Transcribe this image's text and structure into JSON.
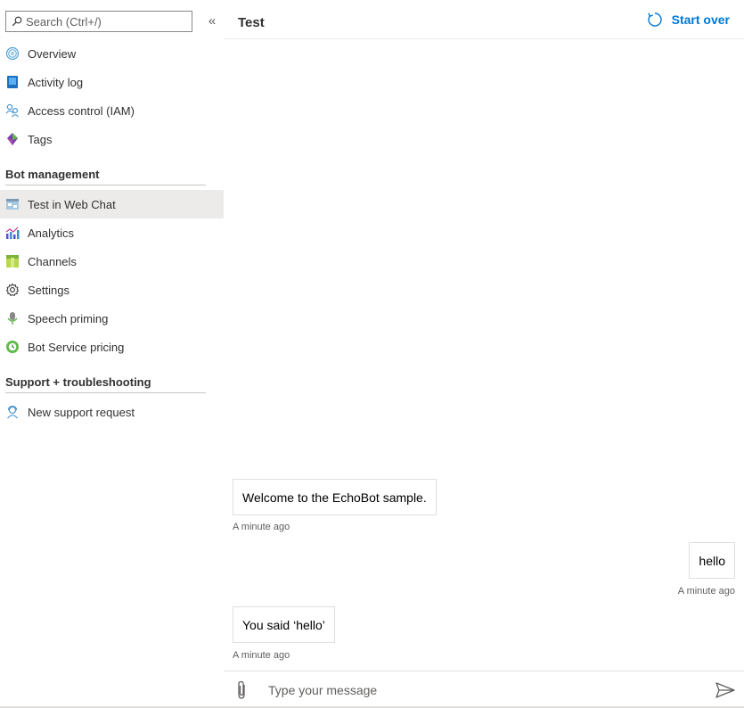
{
  "sidebar": {
    "search": {
      "placeholder": "Search (Ctrl+/)"
    },
    "collapse_glyph": "«",
    "items_top": [
      {
        "label": "Overview",
        "icon": "overview-icon"
      },
      {
        "label": "Activity log",
        "icon": "activity-log-icon"
      },
      {
        "label": "Access control (IAM)",
        "icon": "access-control-icon"
      },
      {
        "label": "Tags",
        "icon": "tags-icon"
      }
    ],
    "sections": [
      {
        "title": "Bot management",
        "items": [
          {
            "label": "Test in Web Chat",
            "icon": "web-chat-icon",
            "active": true
          },
          {
            "label": "Analytics",
            "icon": "analytics-icon"
          },
          {
            "label": "Channels",
            "icon": "channels-icon"
          },
          {
            "label": "Settings",
            "icon": "settings-icon"
          },
          {
            "label": "Speech priming",
            "icon": "speech-priming-icon"
          },
          {
            "label": "Bot Service pricing",
            "icon": "pricing-icon"
          }
        ]
      },
      {
        "title": "Support + troubleshooting",
        "items": [
          {
            "label": "New support request",
            "icon": "support-request-icon"
          }
        ]
      }
    ]
  },
  "main": {
    "title": "Test",
    "start_over_label": "Start over",
    "messages": [
      {
        "from": "bot",
        "text": "Welcome to the EchoBot sample.",
        "time": "A minute ago"
      },
      {
        "from": "user",
        "text": "hello",
        "time": "A minute ago"
      },
      {
        "from": "bot",
        "text": "You said ‘hello’",
        "time": "A minute ago"
      }
    ],
    "input": {
      "placeholder": "Type your message"
    }
  },
  "colors": {
    "accent": "#0078d4",
    "active_bg": "#edebe9",
    "text": "#323130"
  }
}
